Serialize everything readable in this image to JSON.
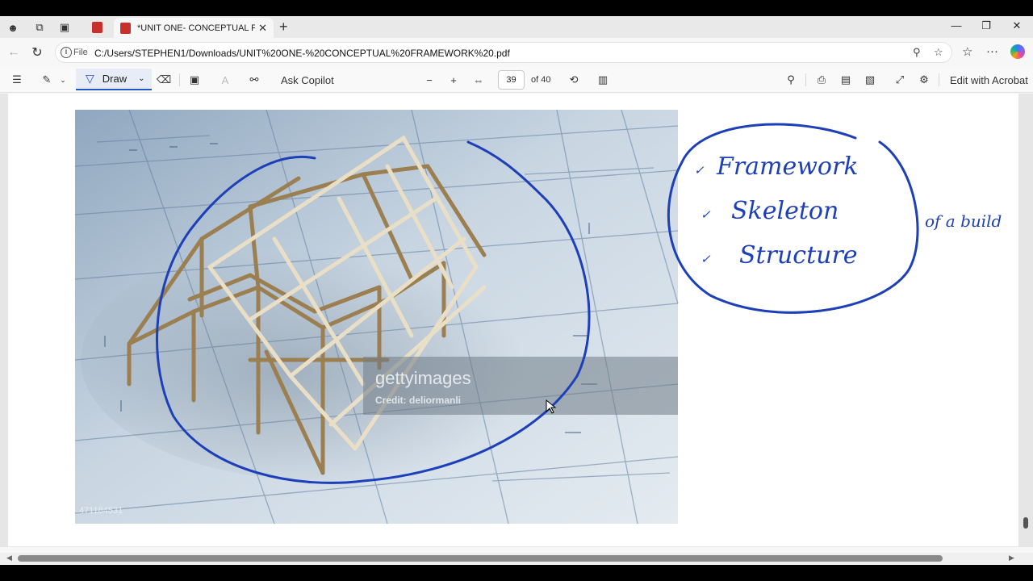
{
  "tab": {
    "title": "*UNIT ONE- CONCEPTUAL FRAME"
  },
  "address": {
    "scheme": "File",
    "url": "C:/Users/STEPHEN1/Downloads/UNIT%20ONE-%20CONCEPTUAL%20FRAMEWORK%20.pdf"
  },
  "pdf_toolbar": {
    "draw_label": "Draw",
    "ask_copilot": "Ask Copilot",
    "page_current": "39",
    "page_total": "of 40",
    "edit_acrobat": "Edit with Acrobat"
  },
  "image": {
    "watermark_brand": "gettyimages",
    "watermark_credit": "Credit: deliormanli",
    "stock_id": "471184531"
  },
  "annotations": {
    "list": [
      "Framework",
      "Skeleton",
      "Structure"
    ],
    "side_note": "of a build"
  },
  "colors": {
    "ink": "#1d3fb8",
    "accent": "#1f55c9",
    "pdf_red": "#c9302c"
  }
}
